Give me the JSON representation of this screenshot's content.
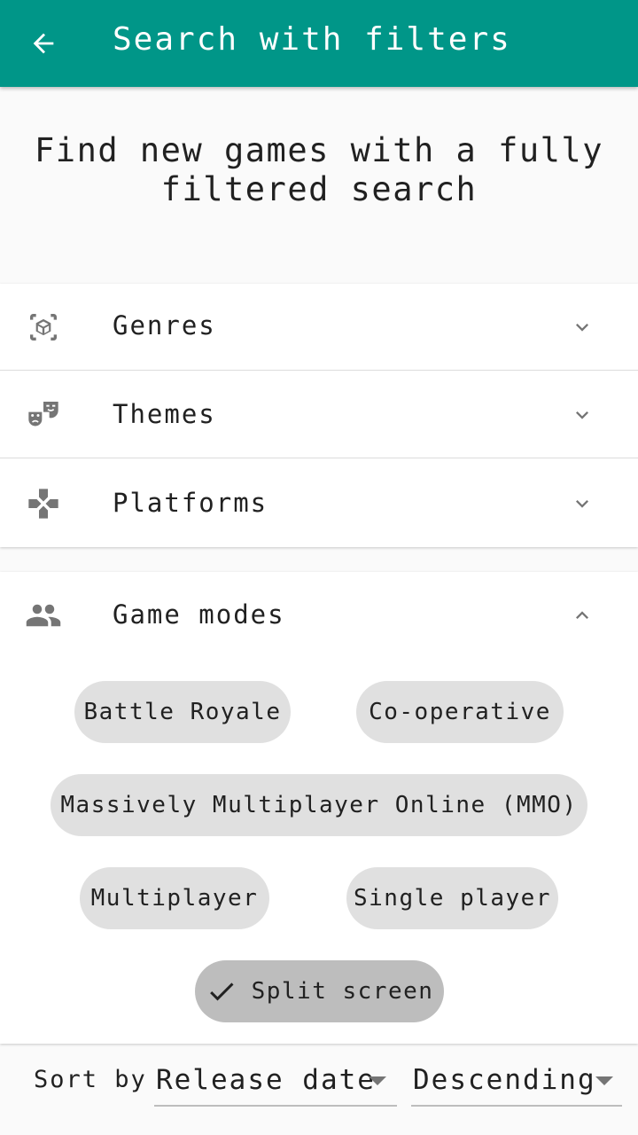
{
  "appbar": {
    "title": "Search with filters",
    "back_icon": "arrow-back-icon",
    "color": "#009688"
  },
  "headline": "Find new games with a fully filtered search",
  "filters": [
    {
      "label": "Genres",
      "icon": "cube-scan-icon",
      "expanded": false
    },
    {
      "label": "Themes",
      "icon": "theater-masks-icon",
      "expanded": false
    },
    {
      "label": "Platforms",
      "icon": "gamepad-icon",
      "expanded": false
    }
  ],
  "game_modes": {
    "label": "Game modes",
    "icon": "people-icon",
    "expanded": true,
    "chips": [
      {
        "label": "Battle Royale",
        "selected": false
      },
      {
        "label": "Co-operative",
        "selected": false
      },
      {
        "label": "Massively Multiplayer Online (MMO)",
        "selected": false
      },
      {
        "label": "Multiplayer",
        "selected": false
      },
      {
        "label": "Single player",
        "selected": false
      },
      {
        "label": "Split screen",
        "selected": true
      }
    ]
  },
  "sort": {
    "label": "Sort by",
    "field_value": "Release date",
    "order_value": "Descending"
  }
}
